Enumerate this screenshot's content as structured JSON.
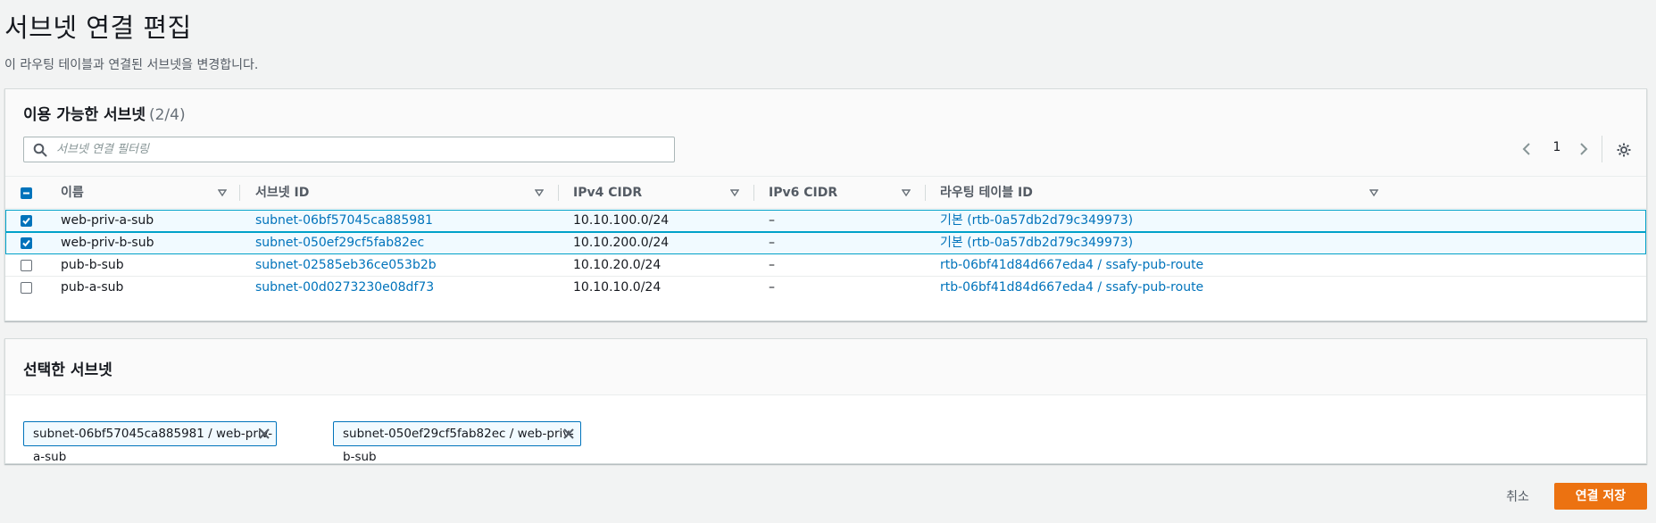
{
  "page": {
    "title": "서브넷 연결 편집",
    "description": "이 라우팅 테이블과 연결된 서브넷을 변경합니다."
  },
  "available": {
    "title": "이용 가능한 서브넷",
    "count": "(2/4)",
    "search_placeholder": "서브넷 연결 필터링",
    "page_number": "1",
    "columns": [
      "이름",
      "서브넷 ID",
      "IPv4 CIDR",
      "IPv6 CIDR",
      "라우팅 테이블 ID"
    ],
    "rows": [
      {
        "checked": true,
        "name": "web-priv-a-sub",
        "subnet_id": "subnet-06bf57045ca885981",
        "ipv4": "10.10.100.0/24",
        "ipv6": "–",
        "route_table": "기본 (rtb-0a57db2d79c349973)"
      },
      {
        "checked": true,
        "name": "web-priv-b-sub",
        "subnet_id": "subnet-050ef29cf5fab82ec",
        "ipv4": "10.10.200.0/24",
        "ipv6": "–",
        "route_table": "기본 (rtb-0a57db2d79c349973)"
      },
      {
        "checked": false,
        "name": "pub-b-sub",
        "subnet_id": "subnet-02585eb36ce053b2b",
        "ipv4": "10.10.20.0/24",
        "ipv6": "–",
        "route_table": "rtb-06bf41d84d667eda4 / ssafy-pub-route"
      },
      {
        "checked": false,
        "name": "pub-a-sub",
        "subnet_id": "subnet-00d0273230e08df73",
        "ipv4": "10.10.10.0/24",
        "ipv6": "–",
        "route_table": "rtb-06bf41d84d667eda4 / ssafy-pub-route"
      }
    ]
  },
  "selected": {
    "title": "선택한 서브넷",
    "tokens": [
      "subnet-06bf57045ca885981 / web-priv-a-sub",
      "subnet-050ef29cf5fab82ec / web-priv-b-sub"
    ]
  },
  "footer": {
    "cancel_label": "취소",
    "save_label": "연결 저장"
  },
  "colors": {
    "accent": "#0073bb",
    "primary_button": "#ec7211",
    "selected_row_border": "#00a1c9"
  },
  "icons": [
    "search-icon",
    "chevron-left-icon",
    "chevron-right-icon",
    "gear-icon",
    "sort-down-icon",
    "check-icon",
    "minus-icon",
    "close-icon"
  ]
}
